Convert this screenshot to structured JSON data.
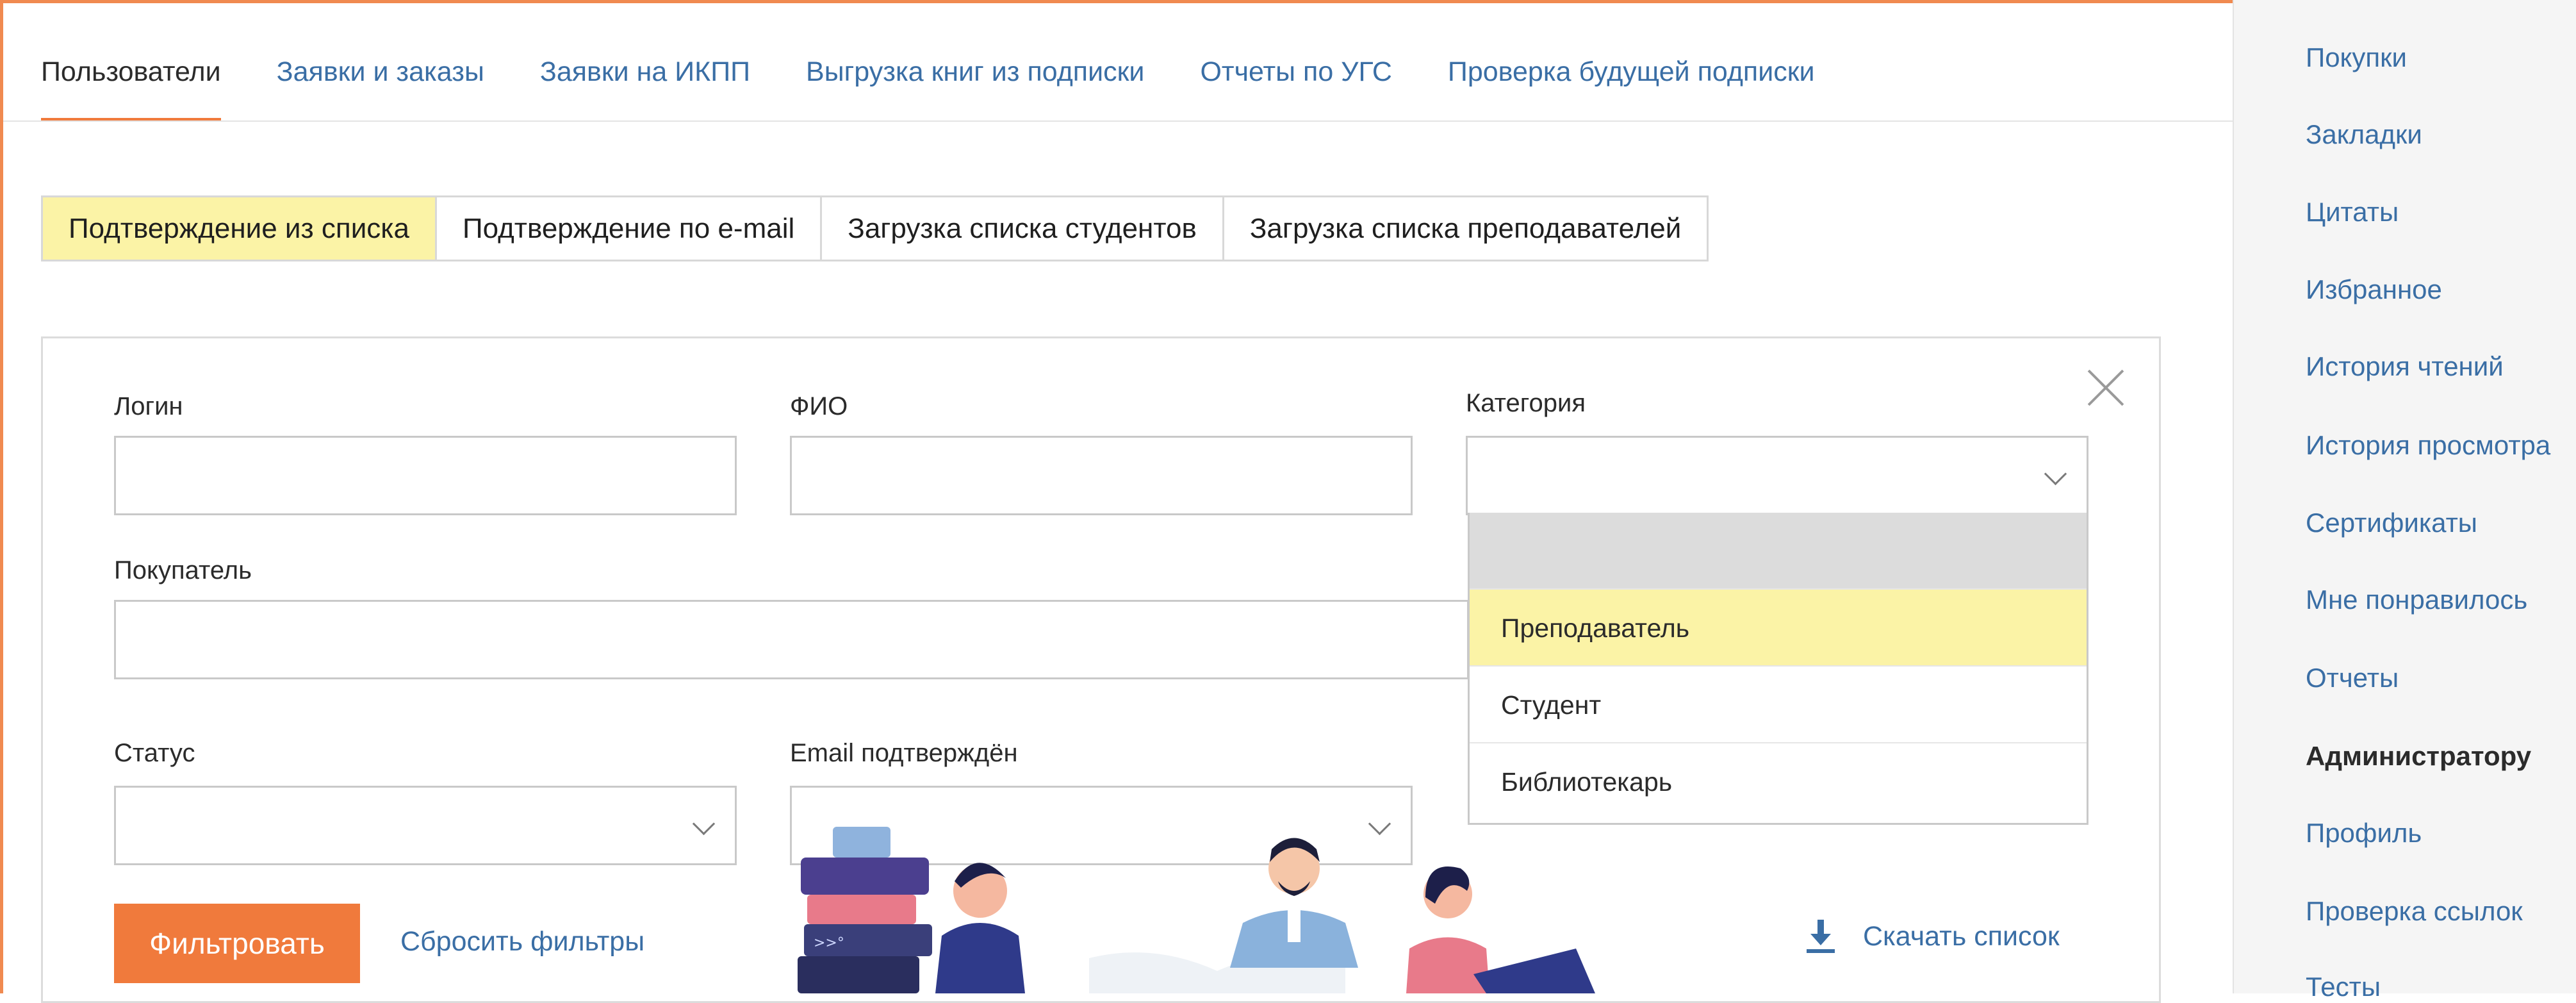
{
  "top_tabs": [
    "Пользователи",
    "Заявки и заказы",
    "Заявки на ИКПП",
    "Выгрузка книг из подписки",
    "Отчеты по УГС",
    "Проверка будущей подписки"
  ],
  "sub_tabs": [
    "Подтверждение из списка",
    "Подтверждение по e-mail",
    "Загрузка списка студентов",
    "Загрузка списка преподавателей"
  ],
  "form": {
    "login_label": "Логин",
    "fio_label": "ФИО",
    "category_label": "Категория",
    "buyer_label": "Покупатель",
    "status_label": "Статус",
    "email_confirmed_label": "Email подтверждён",
    "login_value": "",
    "fio_value": "",
    "buyer_value": ""
  },
  "category_options": [
    "",
    "Преподаватель",
    "Студент",
    "Библиотекарь"
  ],
  "actions": {
    "filter": "Фильтровать",
    "reset": "Сбросить фильтры",
    "download": "Скачать список"
  },
  "sidebar": [
    "Покупки",
    "Закладки",
    "Цитаты",
    "Избранное",
    "История чтений",
    "История просмотра",
    "Сертификаты",
    "Мне понравилось",
    "Отчеты",
    "Администратору",
    "Профиль",
    "Проверка ссылок",
    "Тесты"
  ],
  "colors": {
    "accent": "#f07a3c",
    "link": "#3a6ea5",
    "highlight": "#fbf3a6"
  }
}
